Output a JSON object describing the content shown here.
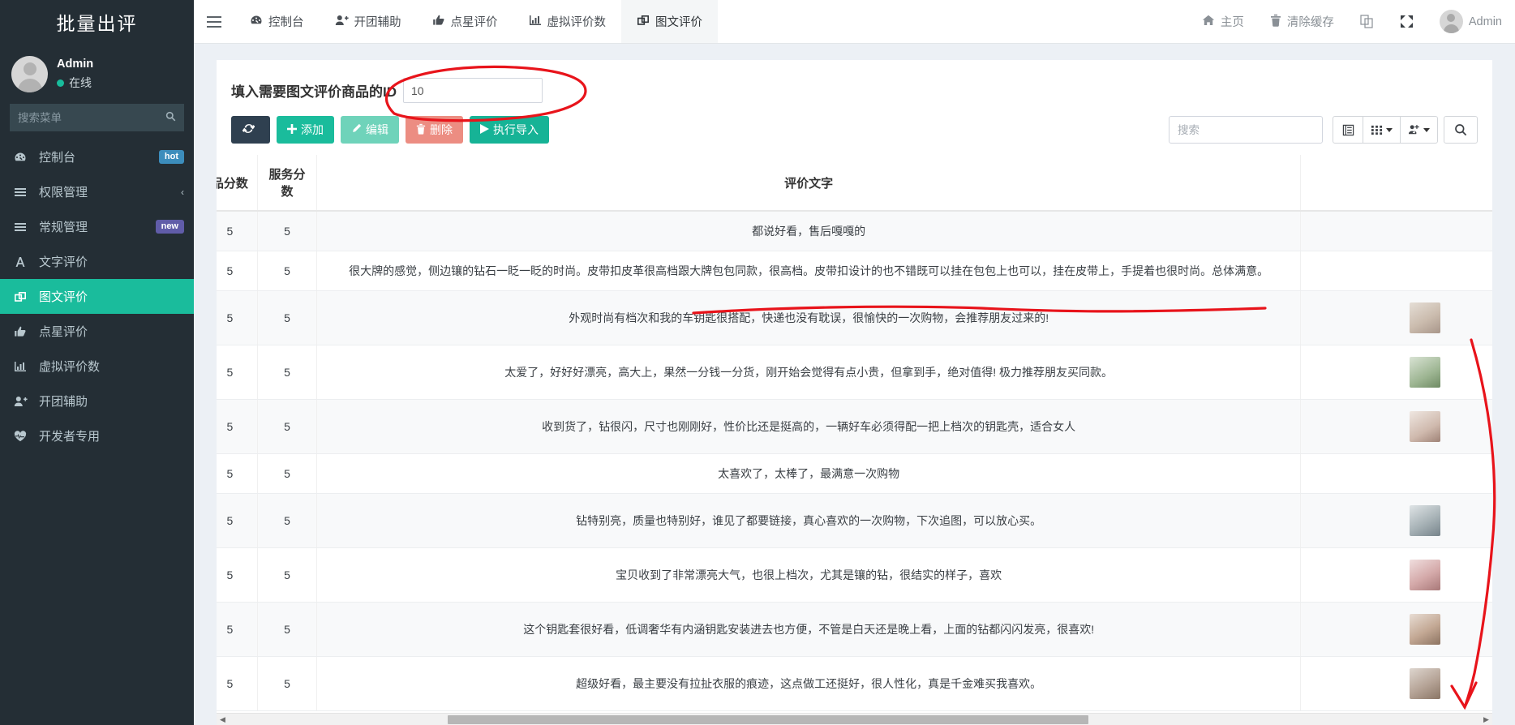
{
  "sidebar": {
    "brand": "批量出评",
    "user": {
      "name": "Admin",
      "status": "在线"
    },
    "search_placeholder": "搜索菜单",
    "items": [
      {
        "label": "控制台",
        "icon": "dashboard-icon",
        "badge": "hot",
        "badge_type": "hot"
      },
      {
        "label": "权限管理",
        "icon": "list-icon",
        "chevron": "‹"
      },
      {
        "label": "常规管理",
        "icon": "list-icon",
        "badge": "new",
        "badge_type": "new"
      },
      {
        "label": "文字评价",
        "icon": "font-icon"
      },
      {
        "label": "图文评价",
        "icon": "clone-icon",
        "active": true
      },
      {
        "label": "点星评价",
        "icon": "thumbs-up-icon"
      },
      {
        "label": "虚拟评价数",
        "icon": "bar-chart-icon"
      },
      {
        "label": "开团辅助",
        "icon": "user-plus-icon"
      },
      {
        "label": "开发者专用",
        "icon": "heartbeat-icon"
      }
    ]
  },
  "topbar": {
    "menu_toggle": "hamburger-icon",
    "nav": [
      {
        "label": "控制台",
        "icon": "dashboard-icon"
      },
      {
        "label": "开团辅助",
        "icon": "user-plus-icon"
      },
      {
        "label": "点星评价",
        "icon": "thumbs-up-icon"
      },
      {
        "label": "虚拟评价数",
        "icon": "bar-chart-icon"
      },
      {
        "label": "图文评价",
        "icon": "clone-icon",
        "active": true
      }
    ],
    "right": [
      {
        "label": "主页",
        "icon": "home-icon"
      },
      {
        "label": "清除缓存",
        "icon": "trash-icon"
      },
      {
        "label": "",
        "icon": "language-icon"
      },
      {
        "label": "",
        "icon": "fullscreen-icon"
      }
    ],
    "user_label": "Admin"
  },
  "page": {
    "id_label": "填入需要图文评价商品的ID",
    "id_value": "10",
    "id_placeholder": ""
  },
  "toolbar": {
    "refresh_label": "",
    "add_label": "添加",
    "edit_label": "编辑",
    "delete_label": "删除",
    "import_label": "执行导入",
    "search_placeholder": "搜索",
    "columns_icon": "columns-icon",
    "grid_icon": "grid-icon",
    "export_icon": "export-icon",
    "search_icon": "search-icon"
  },
  "table": {
    "columns": [
      "品分数",
      "服务分数",
      "评价文字",
      ""
    ],
    "rows": [
      {
        "score": "5",
        "service": "5",
        "text": "都说好看，售后嘎嘎的",
        "thumb": ""
      },
      {
        "score": "5",
        "service": "5",
        "text": "很大牌的感觉，侧边镶的钻石一眨一眨的时尚。皮带扣皮革很高档跟大牌包包同款，很高档。皮带扣设计的也不错既可以挂在包包上也可以，挂在皮带上，手提着也很时尚。总体满意。",
        "thumb": ""
      },
      {
        "score": "5",
        "service": "5",
        "text": "外观时尚有档次和我的车钥匙很搭配，快递也没有耽误，很愉快的一次购物，会推荐朋友过来的!",
        "thumb": "t1"
      },
      {
        "score": "5",
        "service": "5",
        "text": "太爱了，好好好漂亮，高大上，果然一分钱一分货，刚开始会觉得有点小贵，但拿到手，绝对值得! 极力推荐朋友买同款。",
        "thumb": "t2"
      },
      {
        "score": "5",
        "service": "5",
        "text": "收到货了，钻很闪，尺寸也刚刚好，性价比还是挺高的，一辆好车必须得配一把上档次的钥匙壳，适合女人",
        "thumb": "t3"
      },
      {
        "score": "5",
        "service": "5",
        "text": "太喜欢了，太棒了，最满意一次购物",
        "thumb": ""
      },
      {
        "score": "5",
        "service": "5",
        "text": "钻特别亮，质量也特别好，谁见了都要链接，真心喜欢的一次购物，下次追图，可以放心买。",
        "thumb": "t4"
      },
      {
        "score": "5",
        "service": "5",
        "text": "宝贝收到了非常漂亮大气，也很上档次，尤其是镶的钻，很结实的样子，喜欢",
        "thumb": "t5"
      },
      {
        "score": "5",
        "service": "5",
        "text": "这个钥匙套很好看，低调奢华有内涵钥匙安装进去也方便，不管是白天还是晚上看，上面的钻都闪闪发亮，很喜欢!",
        "thumb": "t6"
      },
      {
        "score": "5",
        "service": "5",
        "text": "超级好看，最主要没有拉扯衣服的痕迹，这点做工还挺好，很人性化，真是千金难买我喜欢。",
        "thumb": "t7"
      }
    ]
  },
  "colors": {
    "sidebar_bg": "#242e35",
    "accent": "#1abc9c",
    "danger": "#ec8d82",
    "dark_btn": "#2f4050",
    "annotation": "#e8141b"
  }
}
